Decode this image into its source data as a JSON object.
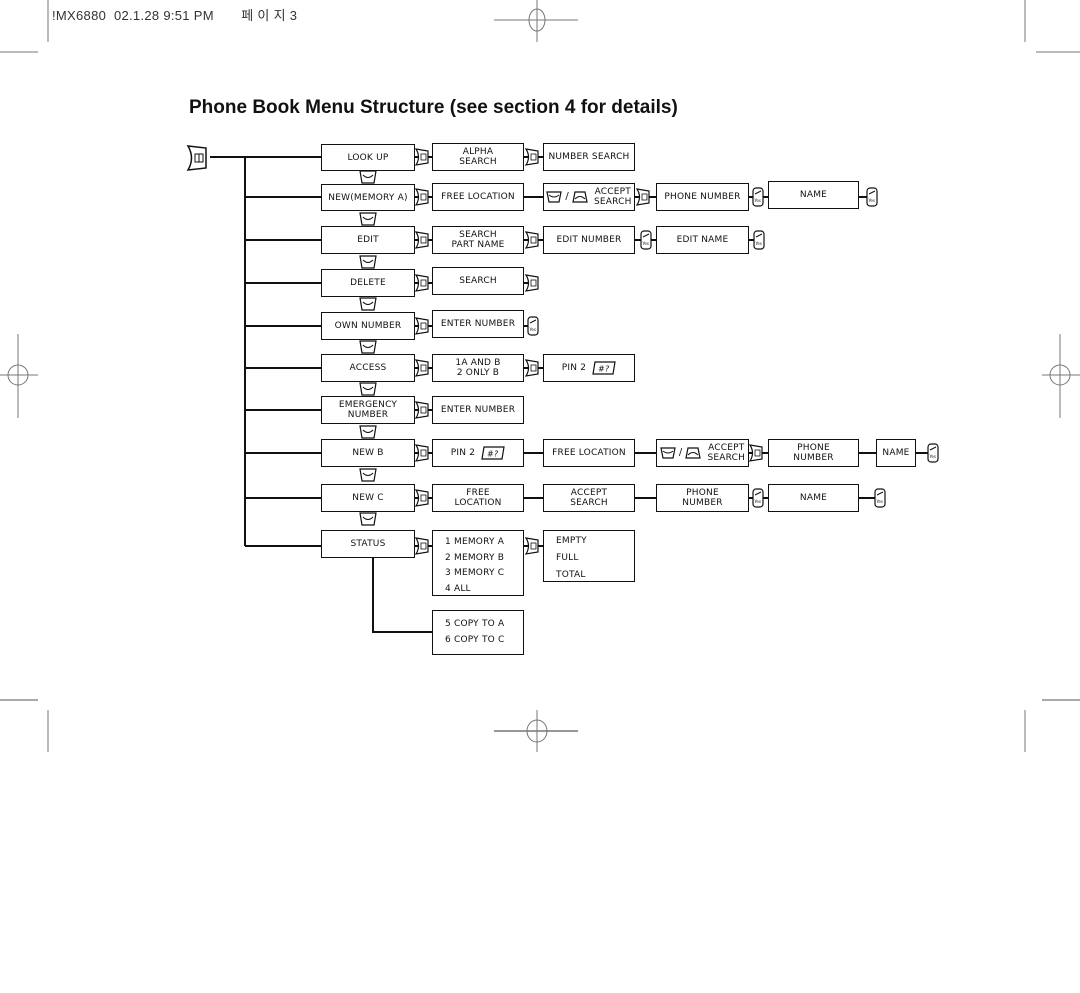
{
  "header": {
    "meta": "!MX6880  02.1.28 9:51 PM       페 이 지 3"
  },
  "title": "Phone Book Menu Structure (see section 4 for details)",
  "root_icon": "phonebook-menu-key-icon",
  "menu": [
    {
      "label": "LOOK UP",
      "steps": [
        "ALPHA\nSEARCH",
        "NUMBER  SEARCH"
      ]
    },
    {
      "label": "NEW(MEMORY  A)",
      "steps": [
        "FREE  LOCATION",
        "ACCEPT\nSEARCH",
        "PHONE  NUMBER",
        "NAME"
      ]
    },
    {
      "label": "EDIT",
      "steps": [
        "SEARCH\nPART NAME",
        "EDIT NUMBER",
        "EDIT NAME"
      ]
    },
    {
      "label": "DELETE",
      "steps": [
        "SEARCH"
      ]
    },
    {
      "label": "OWN NUMBER",
      "steps": [
        "ENTER NUMBER"
      ]
    },
    {
      "label": "ACCESS",
      "steps": [
        "1A AND B\n2  ONLY  B",
        "PIN 2"
      ]
    },
    {
      "label": "EMERGENCY\nNUMBER",
      "steps": [
        "ENTER NUMBER"
      ]
    },
    {
      "label": "NEW  B",
      "steps": [
        "PIN  2",
        "FREE LOCATION",
        "ACCEPT\nSEARCH",
        "PHONE\nNUMBER",
        "NAME"
      ]
    },
    {
      "label": "NEW  C",
      "steps": [
        "FREE\nLOCATION",
        "ACCEPT\nSEARCH",
        "PHONE\nNUMBER",
        "NAME"
      ]
    },
    {
      "label": "STATUS",
      "steps": [
        "1  MEMORY  A\n2  MEMORY  B\n3  MEMORY  C\n4  ALL",
        "EMPTY\nFULL\nTOTAL",
        "5  COPY  TO  A\n6  COPY  TO  C"
      ]
    }
  ],
  "icons": {
    "menu_key": "menu-key-icon",
    "scroll_down": "scroll-down-key-icon",
    "scroll_up": "scroll-up-key-icon",
    "yes_key": "yes-key-icon",
    "hash_key": "hash-key-icon",
    "hash_key_text": "# ?",
    "separator": "/"
  }
}
